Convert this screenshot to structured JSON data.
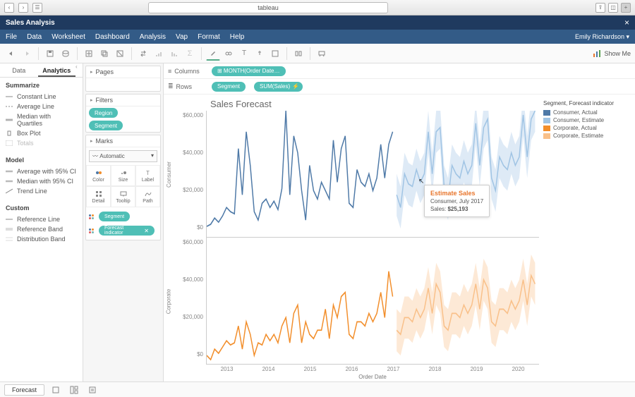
{
  "browser": {
    "address": "tableau"
  },
  "app": {
    "title": "Sales Analysis",
    "user": "Emily Richardson ▾",
    "menu": [
      "File",
      "Data",
      "Worksheet",
      "Dashboard",
      "Analysis",
      "Vap",
      "Format",
      "Help"
    ]
  },
  "toolbar": {
    "show_me": "Show Me"
  },
  "leftpane": {
    "tabs": [
      "Data",
      "Analytics"
    ],
    "summarize_head": "Summarize",
    "summarize": [
      "Constant Line",
      "Average Line",
      "Median with Quartiles",
      "Box Plot",
      "Totals"
    ],
    "model_head": "Model",
    "model": [
      "Average with 95% CI",
      "Median with 95% CI",
      "Trend Line"
    ],
    "custom_head": "Custom",
    "custom": [
      "Reference Line",
      "Reference Band",
      "Distribution Band"
    ]
  },
  "cards": {
    "pages": "Pages",
    "filters": "Filters",
    "filter_items": [
      "Region",
      "Segment"
    ],
    "marks": "Marks",
    "mark_type": "Automatic",
    "mark_cells": [
      "Color",
      "Size",
      "Label",
      "Detail",
      "Tooltip",
      "Path"
    ],
    "mark_pills": [
      "Segment",
      "Forecast indicator"
    ]
  },
  "shelves": {
    "columns_label": "Columns",
    "columns_pill": "⊞ MONTH(Order Date…",
    "rows_label": "Rows",
    "rows_pills": [
      "Segment",
      "SUM(Sales)"
    ]
  },
  "chart": {
    "title": "Sales Forecast",
    "xlabel": "Order Date",
    "panel_labels": [
      "Consumer",
      "Corporate"
    ],
    "y_ticks": [
      "$60,000",
      "$40,000",
      "$20,000",
      "$0"
    ],
    "x_ticks": [
      "2013",
      "2014",
      "2015",
      "2016",
      "2017",
      "2018",
      "2019",
      "2020"
    ]
  },
  "legend": {
    "title": "Segment, Forecast indicator",
    "items": [
      {
        "label": "Consumer, Actual",
        "color": "#4e79a7"
      },
      {
        "label": "Consumer, Estimate",
        "color": "#a0c4e4"
      },
      {
        "label": "Corporate, Actual",
        "color": "#f28e2b"
      },
      {
        "label": "Corporate, Estimate",
        "color": "#f9c089"
      }
    ]
  },
  "tooltip": {
    "title": "Estimate Sales",
    "line1": "Consumer, July 2017",
    "line2_label": "Sales:",
    "line2_value": "$25,193"
  },
  "bottom": {
    "sheet": "Forecast"
  },
  "chart_data": [
    {
      "type": "line",
      "title": "Sales Forecast",
      "xlabel": "Order Date",
      "ylabel": "Consumer",
      "ylim": [
        0,
        60000
      ],
      "x_year_ticks": [
        2013,
        2014,
        2015,
        2016,
        2017,
        2018,
        2019,
        2020
      ],
      "series": [
        {
          "name": "Consumer, Actual",
          "color": "#4e79a7",
          "values_monthly_from_2013": [
            5000,
            6000,
            9000,
            7000,
            10000,
            14000,
            12000,
            11000,
            42000,
            20000,
            50000,
            34000,
            12000,
            8000,
            16000,
            18000,
            14000,
            17000,
            13000,
            23000,
            60000,
            20000,
            48000,
            40000,
            22000,
            8000,
            34000,
            22000,
            18000,
            26000,
            22000,
            18000,
            46000,
            26000,
            42000,
            48000,
            16000,
            14000,
            32000,
            26000,
            24000,
            30000,
            22000,
            28000,
            44000,
            28000,
            44000,
            50000
          ]
        },
        {
          "name": "Consumer, Estimate",
          "color": "#a0c4e4",
          "values_monthly_from_2017": [
            20000,
            14000,
            30000,
            25193,
            24000,
            32000,
            26000,
            30000,
            50000,
            30000,
            50000,
            52000,
            24000,
            18000,
            34000,
            30000,
            28000,
            36000,
            30000,
            34000,
            54000,
            34000,
            52000,
            56000,
            28000,
            22000,
            38000,
            34000,
            32000,
            40000,
            34000,
            38000,
            58000,
            38000,
            56000,
            60000
          ]
        }
      ]
    },
    {
      "type": "line",
      "title": "Sales Forecast",
      "xlabel": "Order Date",
      "ylabel": "Corporate",
      "ylim": [
        0,
        60000
      ],
      "x_year_ticks": [
        2013,
        2014,
        2015,
        2016,
        2017,
        2018,
        2019,
        2020
      ],
      "series": [
        {
          "name": "Corporate, Actual",
          "color": "#f28e2b",
          "values_monthly_from_2013": [
            4000,
            2000,
            7000,
            5000,
            8000,
            11000,
            9000,
            10000,
            18000,
            7000,
            20000,
            14000,
            4000,
            10000,
            9000,
            14000,
            11000,
            14000,
            10000,
            18000,
            22000,
            10000,
            24000,
            28000,
            10000,
            20000,
            14000,
            12000,
            16000,
            16000,
            26000,
            12000,
            28000,
            22000,
            32000,
            34000,
            14000,
            12000,
            20000,
            20000,
            18000,
            24000,
            20000,
            24000,
            34000,
            22000,
            44000,
            32000
          ]
        },
        {
          "name": "Corporate, Estimate",
          "color": "#f9c089",
          "values_monthly_from_2017": [
            16000,
            14000,
            22000,
            22000,
            20000,
            26000,
            22000,
            26000,
            36000,
            24000,
            38000,
            34000,
            18000,
            16000,
            24000,
            24000,
            22000,
            28000,
            24000,
            28000,
            38000,
            26000,
            40000,
            36000,
            20000,
            18000,
            26000,
            26000,
            24000,
            30000,
            26000,
            30000,
            40000,
            28000,
            42000,
            38000
          ]
        }
      ]
    }
  ]
}
